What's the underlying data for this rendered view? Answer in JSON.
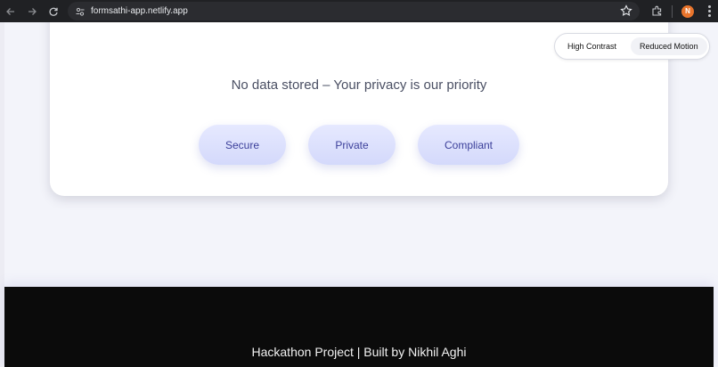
{
  "browser": {
    "url": "formsathi-app.netlify.app",
    "avatar_letter": "N"
  },
  "hero": {
    "tagline": "No data stored – Your privacy is our priority",
    "badges": [
      {
        "label": "Secure"
      },
      {
        "label": "Private"
      },
      {
        "label": "Compliant"
      }
    ]
  },
  "accessibility": {
    "high_contrast_label": "High Contrast",
    "reduced_motion_label": "Reduced Motion"
  },
  "footer": {
    "text": "Hackathon Project | Built by Nikhil Aghi"
  }
}
